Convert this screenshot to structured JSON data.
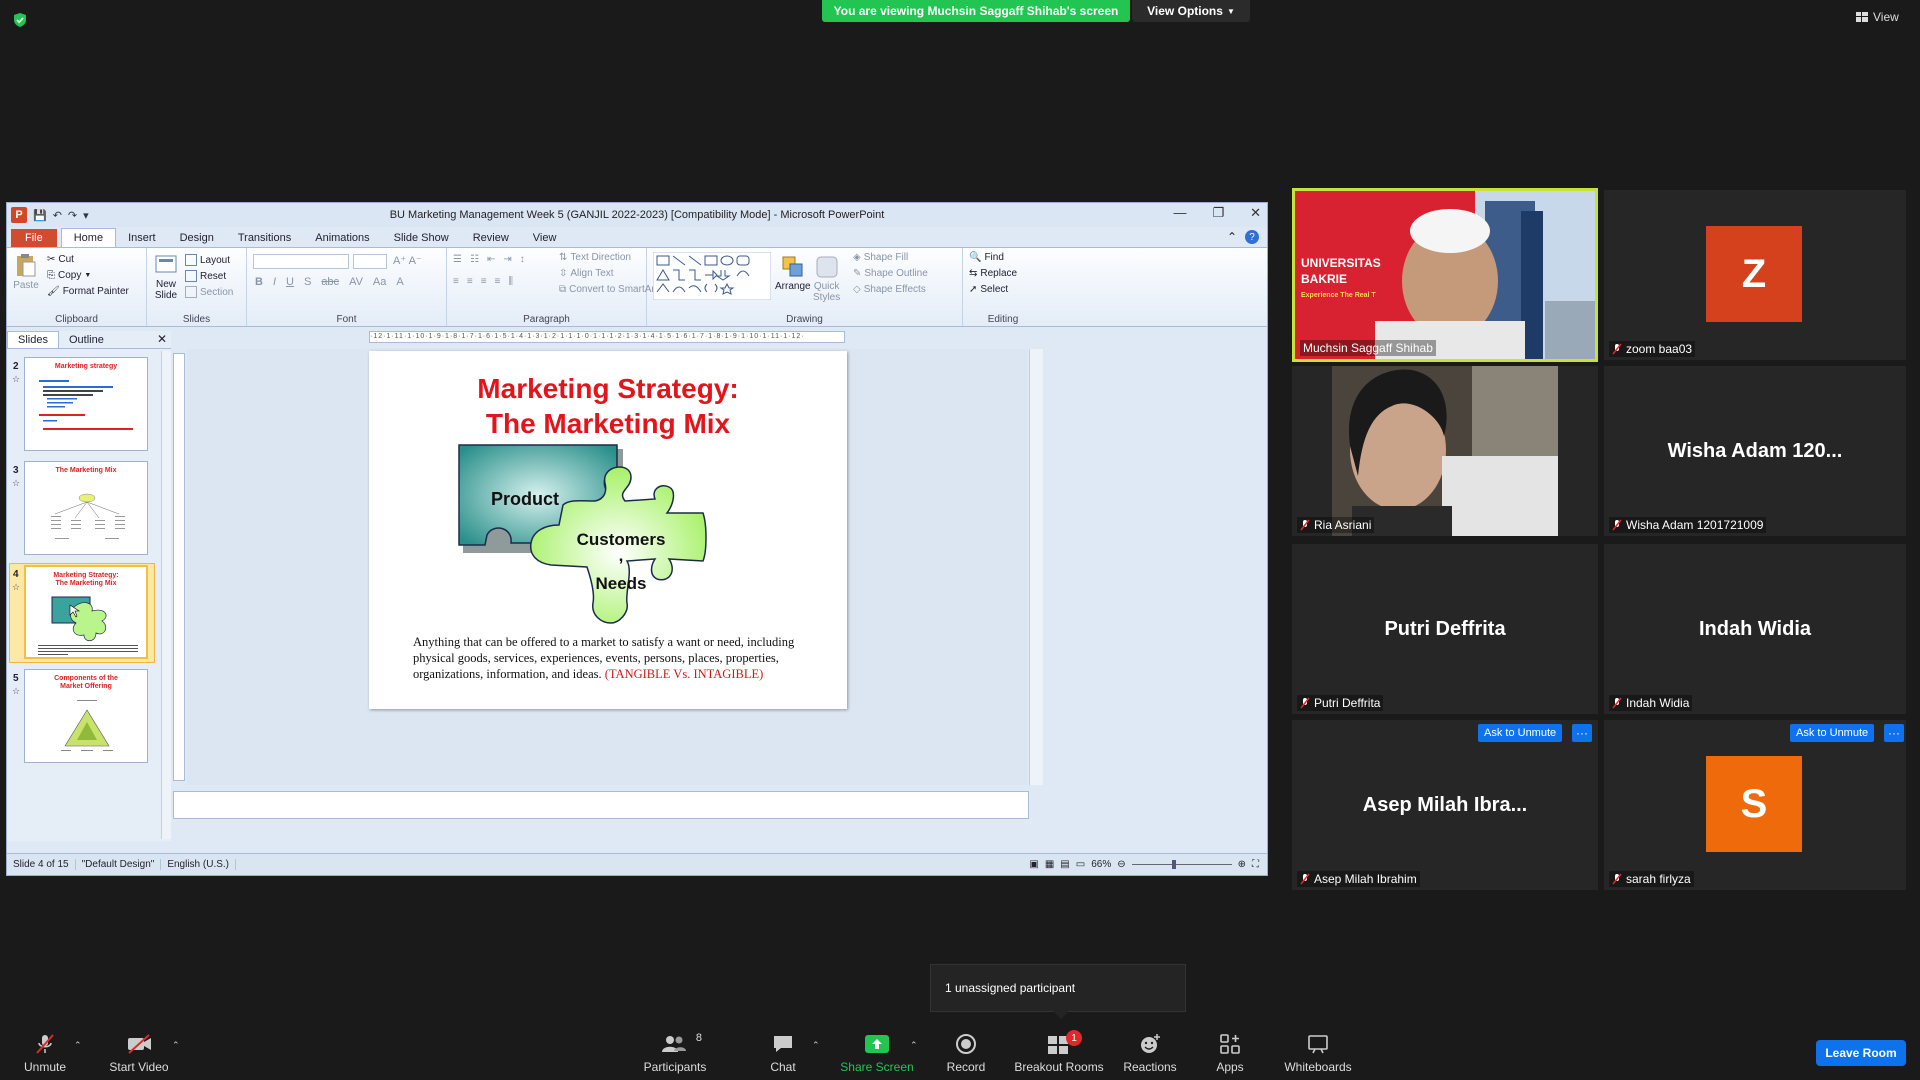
{
  "zoom": {
    "banner": "You are viewing Muchsin Saggaff Shihab's screen",
    "view_options": "View Options",
    "view": "View",
    "unassigned": "1 unassigned participant",
    "toolbar": {
      "unmute": "Unmute",
      "start_video": "Start Video",
      "participants": "Participants",
      "participants_count": "8",
      "chat": "Chat",
      "share_screen": "Share Screen",
      "record": "Record",
      "breakout_rooms": "Breakout Rooms",
      "breakout_badge": "1",
      "reactions": "Reactions",
      "apps": "Apps",
      "whiteboards": "Whiteboards",
      "leave": "Leave Room"
    },
    "ask_to_unmute": "Ask to Unmute",
    "more": "···",
    "participants": [
      {
        "name": "Muchsin Saggaff Shihab",
        "video": true,
        "banner_text": "UNIVERSITAS\nBAKRIE",
        "banner_sub": "Experience The Real T"
      },
      {
        "name": "zoom baa03",
        "avatar": "Z",
        "avatar_color": "#d4411c"
      },
      {
        "name": "Ria Asriani",
        "video": true
      },
      {
        "name": "Wisha Adam 1201721009",
        "display": "Wisha Adam 120..."
      },
      {
        "name": "Putri Deffrita",
        "display": "Putri Deffrita"
      },
      {
        "name": "Indah Widia",
        "display": "Indah Widia"
      },
      {
        "name": "Asep Milah Ibrahim",
        "display": "Asep Milah Ibra..."
      },
      {
        "name": "sarah firlyza",
        "avatar": "S",
        "avatar_color": "#ef6a0b"
      }
    ]
  },
  "ppt": {
    "title": "BU  Marketing Management Week 5 (GANJIL 2022-2023) [Compatibility Mode]  -  Microsoft PowerPoint",
    "tabs": [
      "File",
      "Home",
      "Insert",
      "Design",
      "Transitions",
      "Animations",
      "Slide Show",
      "Review",
      "View"
    ],
    "ribbon": {
      "paste": "Paste",
      "cut": "Cut",
      "copy": "Copy",
      "format_painter": "Format Painter",
      "clipboard": "Clipboard",
      "new_slide": "New\nSlide",
      "layout": "Layout",
      "reset": "Reset",
      "section": "Section",
      "slides": "Slides",
      "font": "Font",
      "text_direction": "Text Direction",
      "align_text": "Align Text",
      "convert_smartart": "Convert to SmartArt",
      "paragraph": "Paragraph",
      "arrange": "Arrange",
      "quick_styles": "Quick\nStyles",
      "shape_fill": "Shape Fill",
      "shape_outline": "Shape Outline",
      "shape_effects": "Shape Effects",
      "drawing": "Drawing",
      "find": "Find",
      "replace": "Replace",
      "select": "Select",
      "editing": "Editing"
    },
    "panel_tabs": [
      "Slides",
      "Outline"
    ],
    "thumbs": [
      {
        "num": "2",
        "title": "Marketing strategy"
      },
      {
        "num": "3",
        "title": "The Marketing Mix"
      },
      {
        "num": "4",
        "title": "Marketing Strategy:\nThe Marketing Mix"
      },
      {
        "num": "5",
        "title": "Components of the\nMarket Offering"
      }
    ],
    "ruler": "·12·1·11·1·10·1·9·1·8·1·7·1·6·1·5·1·4·1·3·1·2·1·1·1·0·1·1·1·2·1·3·1·4·1·5·1·6·1·7·1·8·1·9·1·10·1·11·1·12·",
    "slide": {
      "title_line1": "Marketing Strategy:",
      "title_line2": "The Marketing Mix",
      "product": "Product",
      "customers": "Customers",
      "comma": ",",
      "needs": "Needs",
      "body": "Anything that can be offered to a market to satisfy a want or need, including physical goods, services, experiences, events, persons, places, properties, organizations, information, and ideas.",
      "body_red": "(TANGIBLE Vs. INTAGIBLE)"
    },
    "status": {
      "slide": "Slide 4 of 15",
      "design": "\"Default Design\"",
      "lang": "English (U.S.)",
      "zoom": "66%"
    }
  }
}
